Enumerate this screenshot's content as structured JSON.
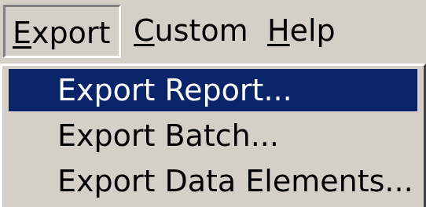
{
  "menubar": {
    "menus": [
      {
        "mnemonic": "E",
        "rest": "xport",
        "open": true
      },
      {
        "mnemonic": "C",
        "rest": "ustom",
        "open": false
      },
      {
        "mnemonic": "H",
        "rest": "elp",
        "open": false
      }
    ]
  },
  "dropdown": {
    "items": [
      {
        "label": "Export Report...",
        "selected": true
      },
      {
        "label": "Export Batch...",
        "selected": false
      },
      {
        "label": "Export Data Elements...",
        "selected": false
      }
    ]
  },
  "colors": {
    "face": "#d4d0c8",
    "highlight": "#0a246a",
    "highlight_text": "#ffffff"
  }
}
